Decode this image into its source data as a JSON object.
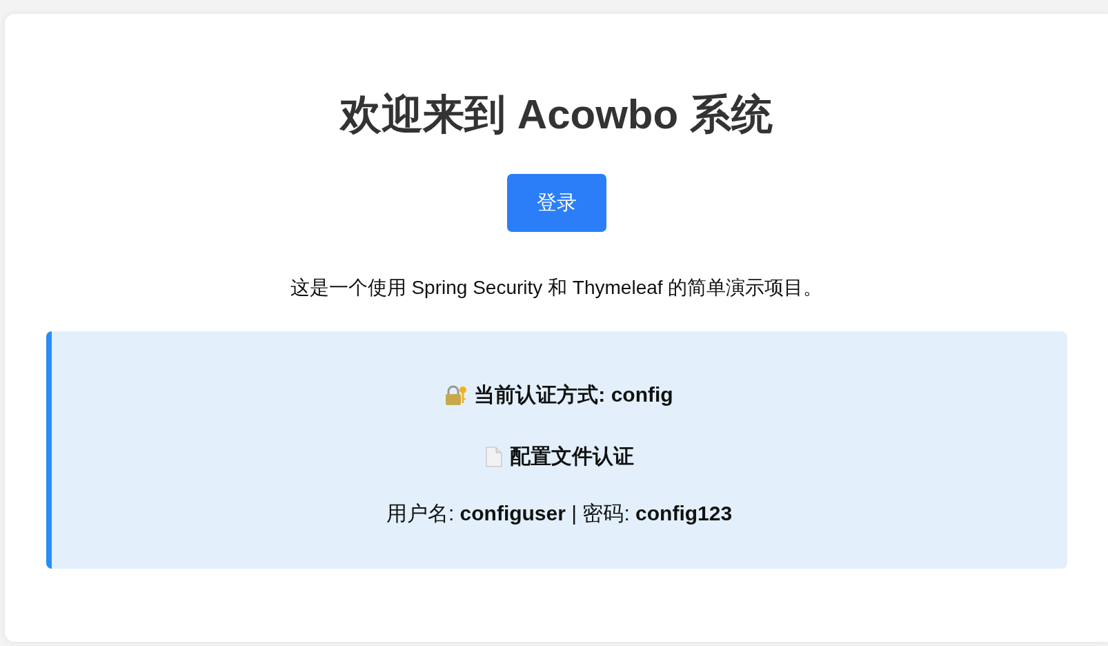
{
  "title": "欢迎来到 Acowbo 系统",
  "login_button": "登录",
  "description": "这是一个使用 Spring Security 和 Thymeleaf 的简单演示项目。",
  "info_box": {
    "auth_mode": "当前认证方式: config",
    "auth_type": "配置文件认证",
    "credentials": "用户名: **configuser** | 密码: **config123**"
  }
}
